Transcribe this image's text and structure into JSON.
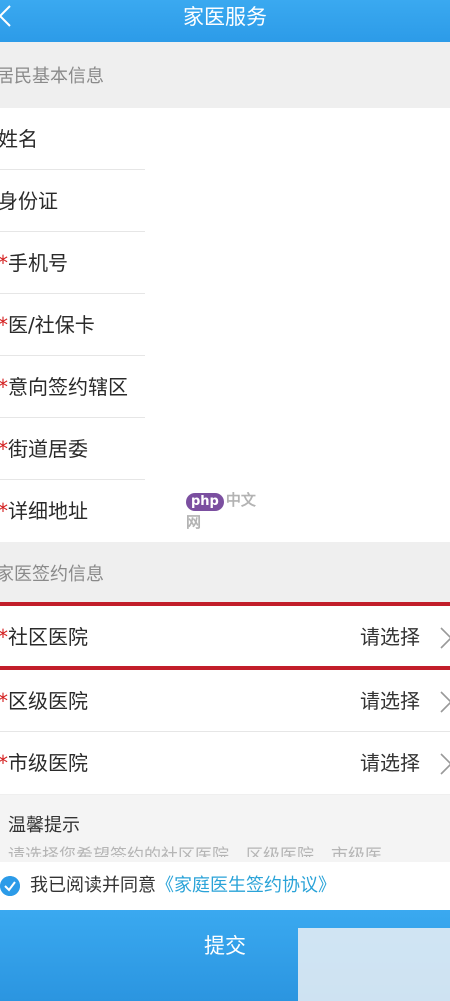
{
  "header": {
    "title": "家医服务"
  },
  "sections": {
    "basic": "居民基本信息",
    "sign": "家医签约信息"
  },
  "basic_rows": [
    {
      "star": "",
      "label": "姓名"
    },
    {
      "star": "",
      "label": "身份证"
    },
    {
      "star": "*",
      "label": "手机号"
    },
    {
      "star": "*",
      "label": "医/社保卡"
    },
    {
      "star": "*",
      "label": "意向签约辖区"
    },
    {
      "star": "*",
      "label": "街道居委"
    },
    {
      "star": "*",
      "label": "详细地址"
    }
  ],
  "sign_rows": [
    {
      "star": "*",
      "label": "社区医院",
      "value": "请选择"
    },
    {
      "star": "*",
      "label": "区级医院",
      "value": "请选择"
    },
    {
      "star": "*",
      "label": "市级医院",
      "value": "请选择"
    }
  ],
  "tips": {
    "title": "温馨提示",
    "body": "请选择您希望签约的社区医院、区级医院、市级医"
  },
  "agree": {
    "text": "我已阅读并同意",
    "link": "《家庭医生签约协议》"
  },
  "submit_label": "提交",
  "watermark": {
    "badge": "php",
    "text": "中文网"
  },
  "colors": {
    "primary": "#2c9be8",
    "required": "#d42020",
    "highlight": "#c21d2a",
    "link": "#2aa3d8"
  }
}
